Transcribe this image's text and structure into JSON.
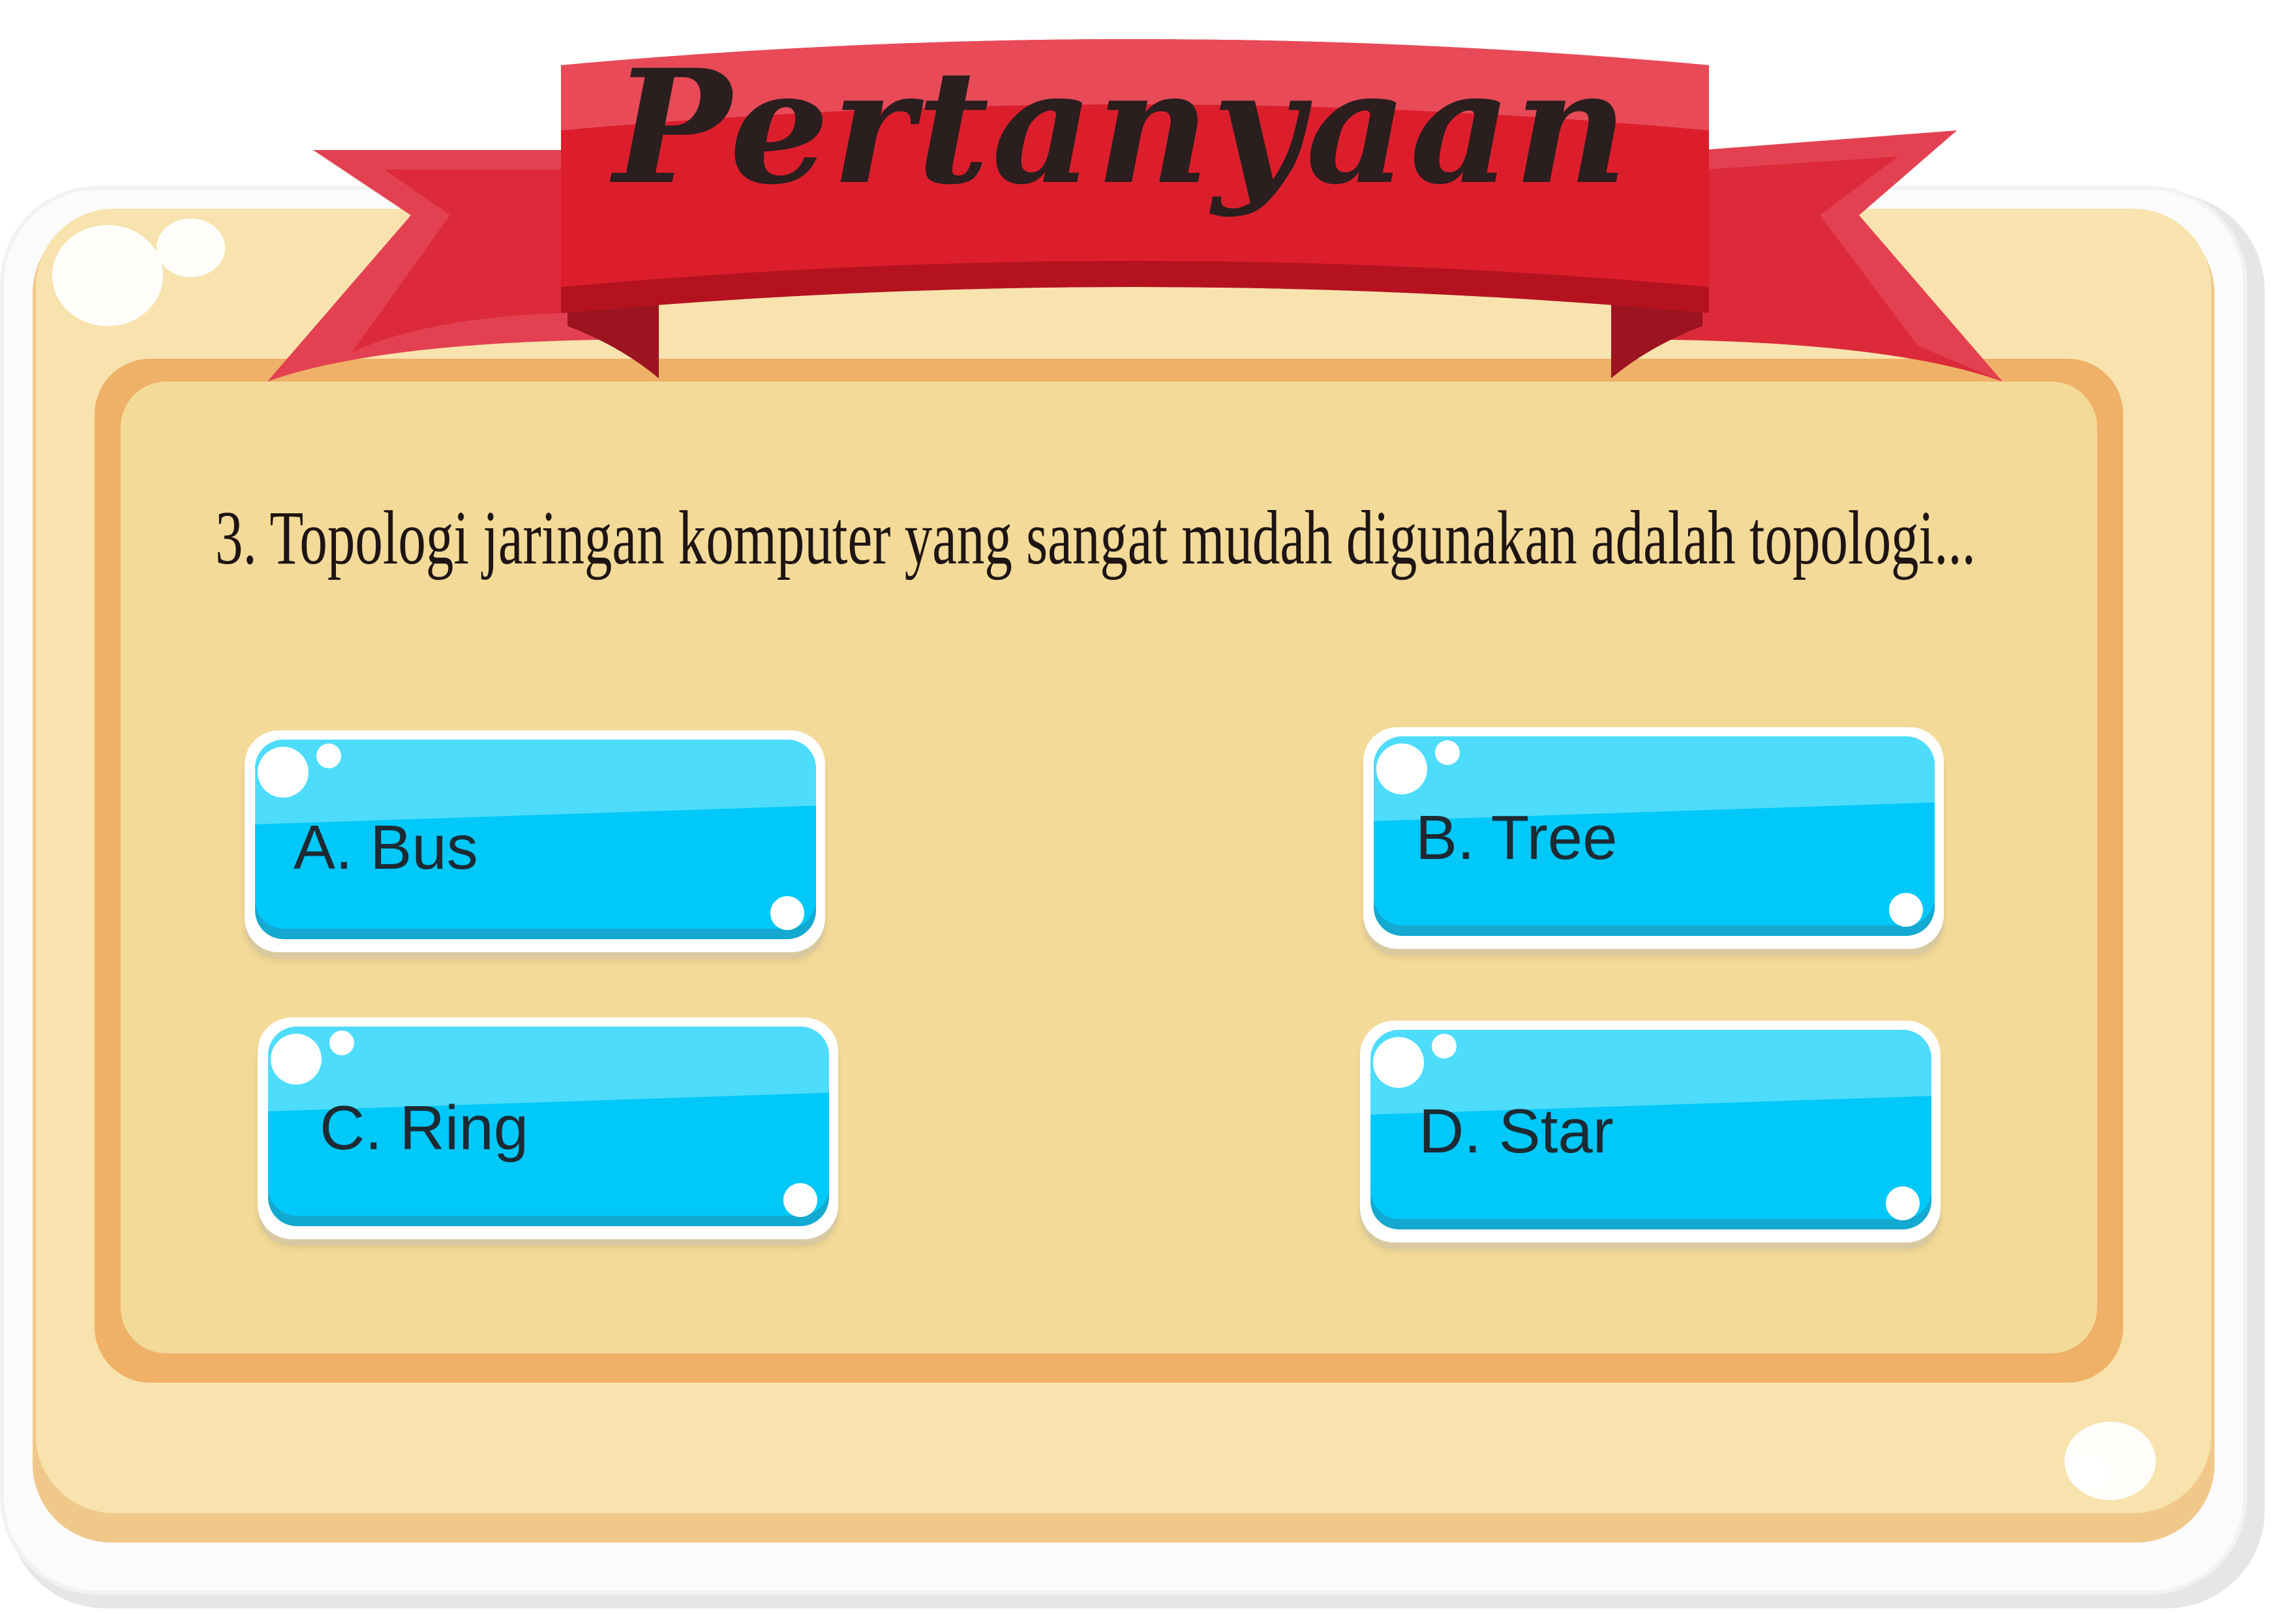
{
  "header": {
    "title": "Pertanyaan"
  },
  "question": {
    "text": "3. Topologi jaringan komputer yang sangat mudah digunakan adalah topologi..."
  },
  "answers": [
    {
      "label": "A. Bus"
    },
    {
      "label": "B. Tree"
    },
    {
      "label": "C. Ring"
    },
    {
      "label": "D. Star"
    }
  ],
  "colors": {
    "ribbon": "#dc1e2c",
    "panel": "#f3da98",
    "frame": "#efb168",
    "button": "#00c8f8",
    "title_text": "#2a1e1e"
  }
}
